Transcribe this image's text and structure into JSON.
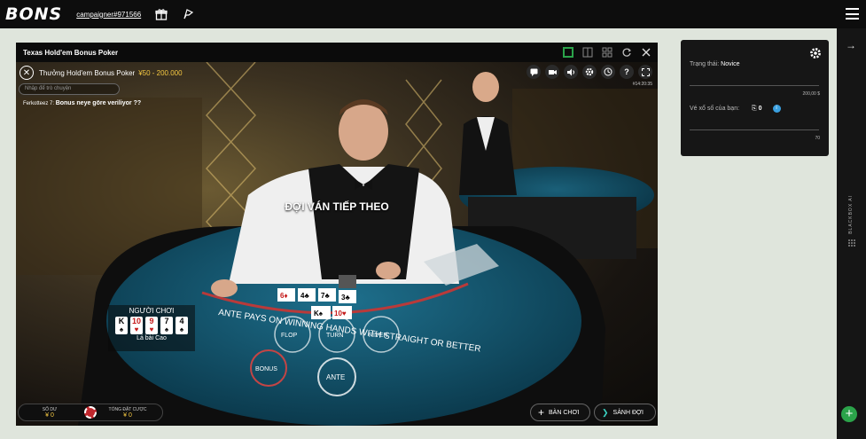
{
  "topbar": {
    "logo": "BONS",
    "campaign_link": "campaigner#971566",
    "icons": [
      "gift-icon",
      "bookmark-icon",
      "hamburger-menu-icon"
    ]
  },
  "game_window": {
    "title": "Texas Hold'em Bonus Poker",
    "header_icons": [
      "layout-single-icon",
      "layout-split-icon",
      "layout-grid-icon",
      "reload-icon",
      "close-icon"
    ],
    "active_accent": "#2ba34a",
    "table_name": "Thưởng Hold'em Bonus Poker",
    "table_limit": "¥50 - 200.000",
    "chat_placeholder": "Nhập để trò chuyện",
    "chat_user": "Ferkotteez 7:",
    "chat_message": "Bonus neye göre veriliyor ??",
    "round_id": "#14:20:35",
    "controls": [
      "chat-icon",
      "camera-icon",
      "volume-icon",
      "settings-icon",
      "history-icon",
      "help-icon",
      "fullscreen-icon"
    ],
    "waiting_text": "ĐỢI VÁN TIẾP THEO",
    "player_box": {
      "title": "NGƯỜI CHƠI",
      "cards": [
        {
          "rank": "K",
          "suit": "♠",
          "red": false
        },
        {
          "rank": "10",
          "suit": "♥",
          "red": true
        },
        {
          "rank": "9",
          "suit": "♥",
          "red": true
        },
        {
          "rank": "7",
          "suit": "♠",
          "red": false
        },
        {
          "rank": "4",
          "suit": "♠",
          "red": false
        }
      ],
      "hand_name": "Lá bài Cao"
    },
    "balance_label": "SỐ DƯ",
    "balance_value": "¥ 0",
    "total_bet_label": "TỔNG ĐẶT CƯỢC",
    "total_bet_value": "¥ 0",
    "tables_button": "BÀN CHƠI",
    "lobby_button": "SẢNH ĐỢI"
  },
  "side_panel": {
    "status_label": "Trạng thái:",
    "status_value": "Novice",
    "progress_value_1": "200,00 $",
    "ticket_label": "Vé xổ số của bạn:",
    "ticket_count": "0",
    "info_glyph": "i",
    "progress_value_2": "70"
  },
  "right_rail": {
    "arrow": "→",
    "blackbox_label": "BLACKBOX AI",
    "plus": "+"
  }
}
